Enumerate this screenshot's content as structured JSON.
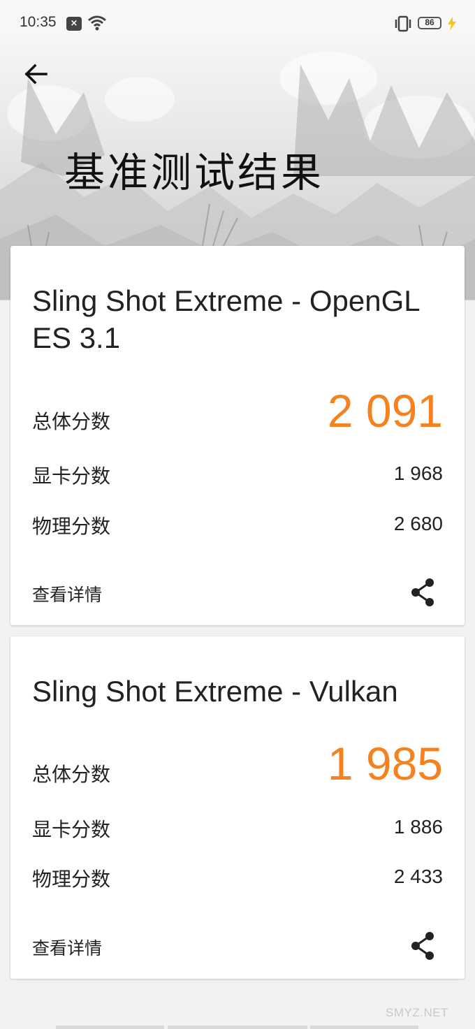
{
  "status_bar": {
    "time": "10:35",
    "notification_glyph": "×",
    "battery_level": "86",
    "icons": [
      "notification-icon",
      "wifi-icon",
      "vibrate-icon",
      "battery-icon",
      "charging-bolt-icon"
    ]
  },
  "header": {
    "title": "基准测试结果",
    "back_icon": "arrow-left-icon"
  },
  "results": [
    {
      "title": "Sling Shot Extreme - OpenGL ES 3.1",
      "overall_label": "总体分数",
      "overall_value": "2 091",
      "graphics_label": "显卡分数",
      "graphics_value": "1 968",
      "physics_label": "物理分数",
      "physics_value": "2 680",
      "details_label": "查看详情",
      "share_icon": "share-icon"
    },
    {
      "title": "Sling Shot Extreme - Vulkan",
      "overall_label": "总体分数",
      "overall_value": "1 985",
      "graphics_label": "显卡分数",
      "graphics_value": "1 886",
      "physics_label": "物理分数",
      "physics_value": "2 433",
      "details_label": "查看详情",
      "share_icon": "share-icon"
    }
  ],
  "watermark": "SMYZ.NET",
  "colors": {
    "accent": "#f5821f",
    "background": "#f2f2f2",
    "card": "#ffffff",
    "text": "#222222"
  }
}
